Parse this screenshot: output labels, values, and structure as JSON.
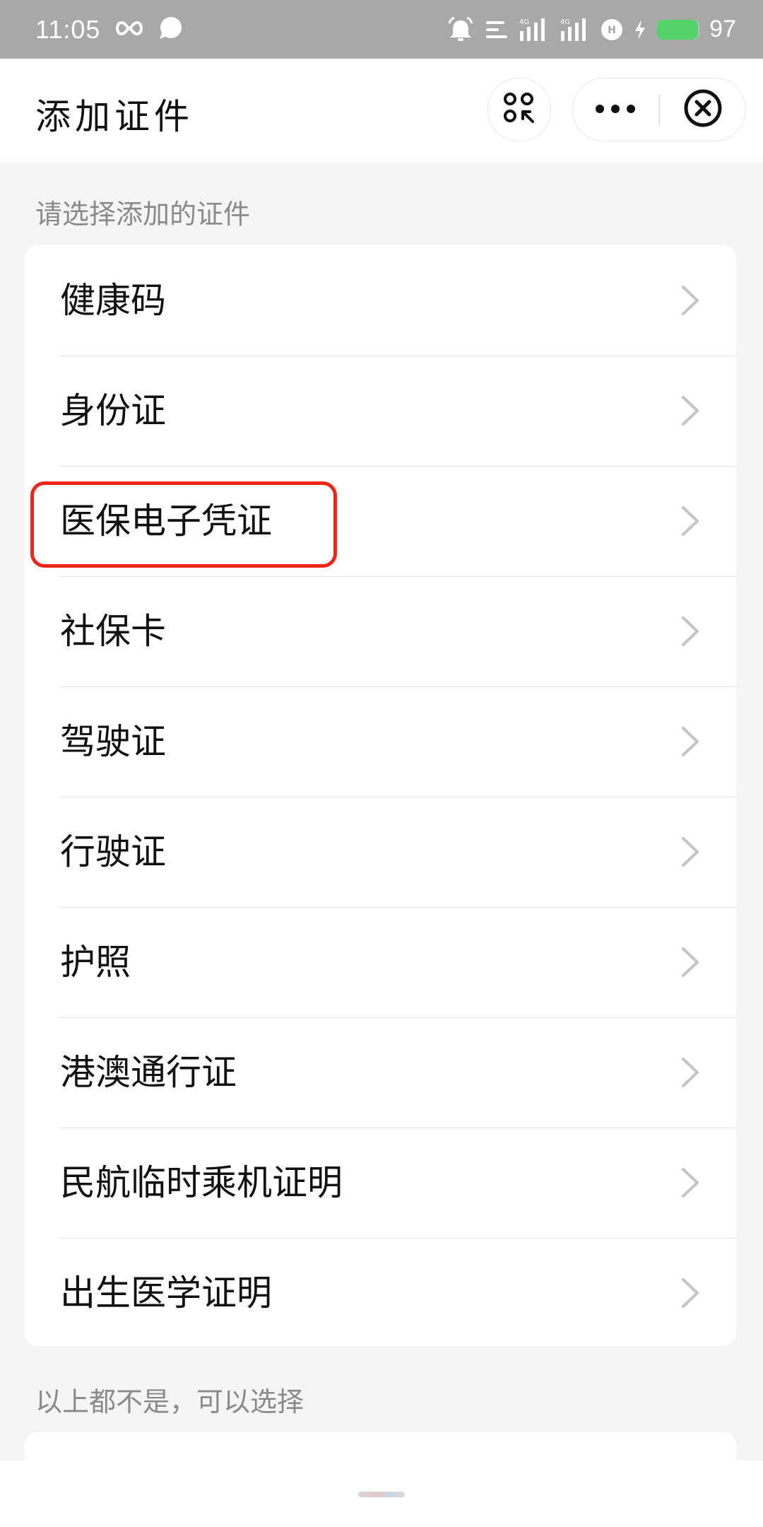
{
  "status_bar": {
    "time": "11:05",
    "battery": "97",
    "battery_level": 0.97,
    "icons": [
      "infinity-icon",
      "chat-bubble-icon",
      "alarm-icon",
      "notification-lines-icon",
      "signal-4g-icon",
      "signal-4g-icon",
      "hd-icon",
      "charging-icon",
      "battery-icon"
    ],
    "network_label": "4G",
    "hd_label": "H"
  },
  "header": {
    "title": "添加证件",
    "icons": [
      "scan-icon",
      "more-dots-icon",
      "close-circle-icon"
    ]
  },
  "section_title": "请选择添加的证件",
  "items": [
    {
      "label": "健康码"
    },
    {
      "label": "身份证"
    },
    {
      "label": "医保电子凭证"
    },
    {
      "label": "社保卡"
    },
    {
      "label": "驾驶证"
    },
    {
      "label": "行驶证"
    },
    {
      "label": "护照"
    },
    {
      "label": "港澳通行证"
    },
    {
      "label": "民航临时乘机证明"
    },
    {
      "label": "出生医学证明"
    }
  ],
  "other_section_title": "以上都不是，可以选择",
  "colors": {
    "highlight": "#f0251a",
    "status_bar_bg": "#a8a8a8",
    "page_bg": "#f5f5f5",
    "battery": "#55d36b"
  }
}
